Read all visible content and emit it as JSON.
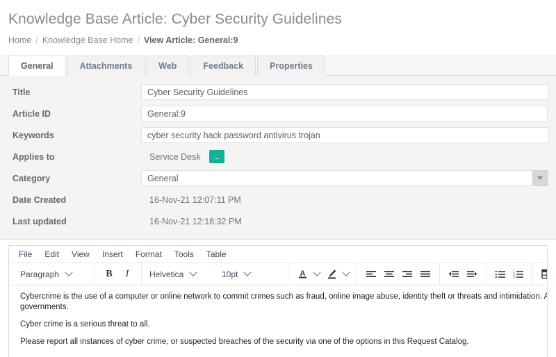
{
  "header": {
    "title": "Knowledge Base Article: Cyber Security Guidelines",
    "breadcrumb": {
      "home": "Home",
      "kb_home": "Knowledge Base Home",
      "current": "View Article: General:9",
      "separator": "/"
    }
  },
  "tabs": [
    {
      "label": "General",
      "active": true
    },
    {
      "label": "Attachments",
      "active": false
    },
    {
      "label": "Web",
      "active": false
    },
    {
      "label": "Feedback",
      "active": false
    },
    {
      "label": "Properties",
      "active": false
    }
  ],
  "form": {
    "title": {
      "label": "Title",
      "value": "Cyber Security Guidelines",
      "placeholder": ""
    },
    "article_id": {
      "label": "Article ID",
      "value": "General:9",
      "placeholder": ""
    },
    "keywords": {
      "label": "Keywords",
      "value": "cyber security hack password antivirus trojan",
      "placeholder": ""
    },
    "applies_to": {
      "label": "Applies to",
      "value": "Service Desk",
      "button_label": "..."
    },
    "category": {
      "label": "Category",
      "value": "General",
      "options": [
        "General"
      ]
    },
    "date_created": {
      "label": "Date Created",
      "value": "16-Nov-21 12:07:11 PM"
    },
    "last_updated": {
      "label": "Last updated",
      "value": "16-Nov-21 12:18:32 PM"
    }
  },
  "editor": {
    "menubar": [
      "File",
      "Edit",
      "View",
      "Insert",
      "Format",
      "Tools",
      "Table"
    ],
    "toolbar": {
      "block_format": "Paragraph",
      "bold": "B",
      "italic": "I",
      "font_family": "Helvetica",
      "font_size": "10pt",
      "icons": [
        "text-color-icon",
        "highlight-color-icon",
        "align-left-icon",
        "align-center-icon",
        "align-right-icon",
        "align-justify-icon",
        "outdent-icon",
        "indent-icon",
        "bullet-list-icon",
        "numbered-list-icon",
        "table-icon",
        "link-icon"
      ]
    },
    "body": [
      "Cybercrime is the use of a computer or online network to commit crimes such as fraud, online image abuse, identity theft or threats and intimidation. As cybercrime",
      "governments.",
      "Cyber crime is a serious threat to all.",
      "Please report all instances of cyber crime, or suspected breaches of the security via one of the options in this Request Catalog."
    ]
  },
  "colors": {
    "accent_green": "#13b294",
    "title_gray": "#8a8a8a",
    "label_gray": "#5f6b75",
    "form_bg": "#f4f4f4"
  }
}
